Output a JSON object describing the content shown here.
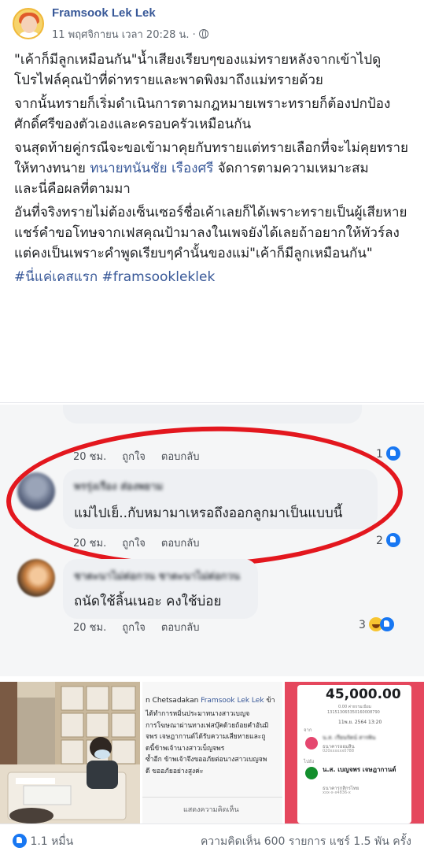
{
  "header": {
    "page_name": "Framsook Lek Lek",
    "timestamp": "11 พฤศจิกายน เวลา 20:28 น. ·"
  },
  "post": {
    "p1": "\"เค้าก็มีลูกเหมือนกัน\"น้ำเสียงเรียบๆของแม่ทรายหลังจากเข้าไปดูโปรไฟล์คุณป้าที่ด่าทรายและพาดพิงมาถึงแม่ทรายด้วย",
    "p2": "จากนั้นทรายก็เริ่มดำเนินการตามกฎหมายเพราะทรายก็ต้องปกป้องศักดิ์ศรีของตัวเองและครอบครัวเหมือนกัน",
    "p3_before": "จนสุดท้ายคู่กรณีจะขอเข้ามาคุยกับทรายแต่ทรายเลือกที่จะไม่คุยทรายให้ทางทนาย ",
    "p3_link": "ทนายทนันชัย เรืองศรี",
    "p3_after": " จัดการตามความเหมาะสม",
    "p3_line2": "และนี่คือผลที่ตามมา",
    "p4": "อันที่จริงทรายไม่ต้องเซ็นเซอร์ชื่อเค้าเลยก็ได้เพราะทรายเป็นผู้เสียหายแชร์คำขอโทษจากเฟสคุณป้ามาลงในเพจยังได้เลยถ้าอยากให้ทัวร์ลง แต่คงเป็นเพราะคำพูดเรียบๆคำนั้นของแม่\"เค้าก็มีลูกเหมือนกัน\"",
    "hashtags": "#นี่แค่เคสแรก #framsookleklek"
  },
  "screenshot": {
    "top_meta": {
      "time": "20 ชม.",
      "like": "ถูกใจ",
      "reply": "ตอบกลับ",
      "count": "1"
    },
    "comment1": {
      "name": "พรรุ่งเรือง ส่องพยาม",
      "text": "แม่ไปเย็..กับหมามาเหรอถึงออกลูกมาเป็นแบบนี้",
      "time": "20 ชม.",
      "like": "ถูกใจ",
      "reply": "ตอบกลับ",
      "count": "2"
    },
    "comment2": {
      "name": "ชาตะนาไม่ต่อกวน ชาตะนาไม่ต่อกวน",
      "text": "ถนัดใช้ลิ้นเนอะ คงใช้บ่อย",
      "time": "20 ชม.",
      "like": "ถูกใจ",
      "reply": "ตอบกลับ",
      "count": "3"
    },
    "highlight_color": "#e3171e"
  },
  "photos": {
    "middle": {
      "author_prefix": "n Chetsadakan ",
      "author_link": "Framsook Lek Lek",
      "author_suffix": " ข้า",
      "lines": [
        "ได้ทำการหมิ่นประมาทนางสาวเบญจ",
        "การโฆษณาผ่านทางเฟสบุ๊คด้วยถ้อยคำอันมิ",
        "จพร เจษฎากานต์ได้รับความเสียหายและถู",
        "ดนี้ข้าพเจ้านางสาวเบ็ญจพร",
        "ซ้ำอีก ข้าพเจ้าจึงขออภัยต่อนางสาวเบญจพ",
        "ดี ขออภัยอย่างสูงค่ะ"
      ],
      "action": "แสดงความคิดเห็น"
    },
    "right": {
      "amount": "45,000.00",
      "small1": "0.00 ค่าธรรมเนียม",
      "ref": "131513065350160008790",
      "date": "11พ.ย. 2564   13:20",
      "from_label": "จาก",
      "from_name": "น.ส. เรียนรัตน์ สารพิน",
      "from_bank": "ธนาคารออมสิน",
      "from_acct": "020xxxxxx0788",
      "to_label": "ไปยัง",
      "to_name": "น.ส. เบญจพร เจษฎากานต์",
      "to_bank": "ธนาคารกสิกรไทย",
      "to_acct": "xxx-x-x4836-x"
    }
  },
  "footer": {
    "reactions": "1.1 หมื่น",
    "stats": "ความคิดเห็น 600 รายการ  แชร์ 1.5 พัน ครั้ง"
  }
}
